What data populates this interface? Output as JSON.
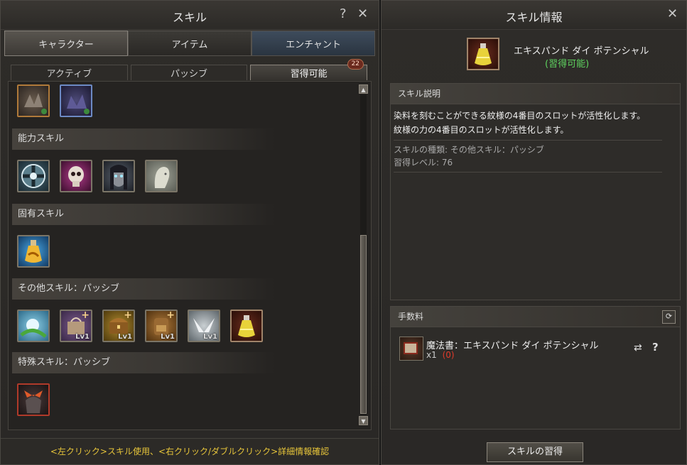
{
  "left_window": {
    "title": "スキル",
    "help_label": "?",
    "close_label": "✕",
    "main_tabs": [
      {
        "label": "キャラクター"
      },
      {
        "label": "アイテム"
      },
      {
        "label": "エンチャント"
      }
    ],
    "sub_tabs": [
      {
        "label": "アクティブ"
      },
      {
        "label": "パッシブ"
      },
      {
        "label": "習得可能",
        "badge": "22"
      }
    ],
    "sections": [
      {
        "name": "能力スキル"
      },
      {
        "name": "固有スキル"
      },
      {
        "name": "その他スキル：パッシブ"
      },
      {
        "name": "特殊スキル：パッシブ"
      }
    ],
    "level_badges": [
      "Lv1",
      "Lv1",
      "Lv1",
      "Lv1"
    ],
    "hint": "<左クリック>スキル使用、<右クリック/ダブルクリック>詳細情報確認"
  },
  "right_window": {
    "title": "スキル情報",
    "close_label": "✕",
    "skill_name": "エキスパンド ダイ ポテンシャル",
    "skill_status": "(習得可能)",
    "desc_header": "スキル説明",
    "desc_line1": "染料を刻むことができる紋様の4番目のスロットが活性化します。",
    "desc_line2": "紋様の力の4番目のスロットが活性化します。",
    "type_label": "スキルの種類: その他スキル：パッシブ",
    "level_label": "習得レベル: 76",
    "fee_header": "手数料",
    "fee_item_name": "魔法書：エキスパンド ダイ ポテンシャル",
    "fee_qty": "x1",
    "fee_have": "(0)",
    "learn_button": "スキルの習得"
  },
  "colors": {
    "hint_text": "#e7c53a",
    "status_green": "#5fd35f",
    "missing_red": "#e03a2a"
  }
}
